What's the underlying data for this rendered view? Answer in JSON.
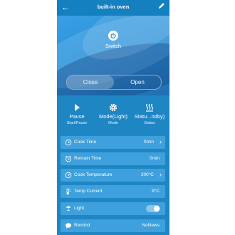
{
  "header": {
    "title": "built-in oven"
  },
  "hero": {
    "switch_label": "Switch"
  },
  "segmented": {
    "close_label": "Close",
    "open_label": "Open",
    "selected": "Close"
  },
  "modes": [
    {
      "label": "Pause",
      "sub": "Start/Pause"
    },
    {
      "label": "Mode(Light)",
      "sub": "Mode"
    },
    {
      "label": "Statu...ndby)",
      "sub": "Status"
    }
  ],
  "rows": {
    "cook_time": {
      "label": "Cook Time",
      "value": "0min"
    },
    "remain_time": {
      "label": "Remain Time",
      "value": "0min"
    },
    "cook_temp": {
      "label": "Cook Temperature",
      "value": "200°C"
    },
    "temp_current": {
      "label": "Temp Current",
      "value": "9°C"
    },
    "light": {
      "label": "Light",
      "on": true
    },
    "remind": {
      "label": "Remind",
      "value": "NoNews"
    }
  },
  "colors": {
    "app_bg": "#1f86c4",
    "row_bg": "#3ea0dc",
    "header_bg": "#1480c0"
  }
}
